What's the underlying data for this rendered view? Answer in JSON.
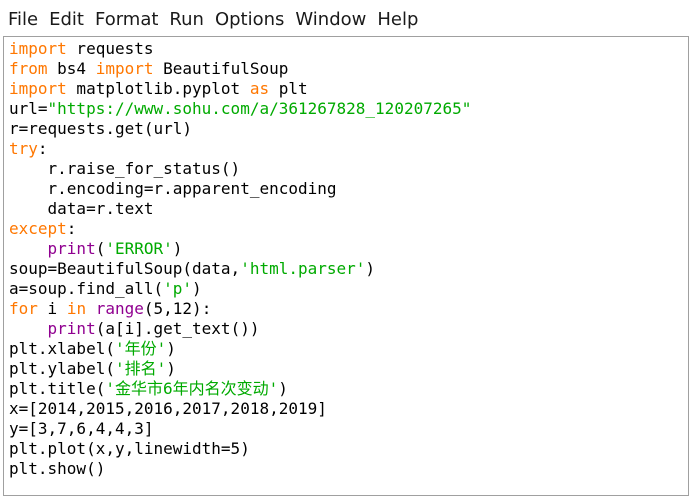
{
  "menubar": {
    "items": [
      "File",
      "Edit",
      "Format",
      "Run",
      "Options",
      "Window",
      "Help"
    ]
  },
  "colors": {
    "keyword": "#ff7700",
    "builtin": "#900090",
    "string": "#00aa00",
    "text": "#000000"
  },
  "editor": {
    "lines": [
      [
        {
          "t": "import",
          "c": "kw"
        },
        {
          "t": " requests"
        }
      ],
      [
        {
          "t": "from",
          "c": "kw"
        },
        {
          "t": " bs4 "
        },
        {
          "t": "import",
          "c": "kw"
        },
        {
          "t": " BeautifulSoup"
        }
      ],
      [
        {
          "t": "import",
          "c": "kw"
        },
        {
          "t": " matplotlib.pyplot "
        },
        {
          "t": "as",
          "c": "kw"
        },
        {
          "t": " plt"
        }
      ],
      [
        {
          "t": "url="
        },
        {
          "t": "\"https://www.sohu.com/a/361267828_120207265\"",
          "c": "str"
        }
      ],
      [
        {
          "t": "r=requests.get(url)"
        }
      ],
      [
        {
          "t": "try",
          "c": "kw"
        },
        {
          "t": ":"
        }
      ],
      [
        {
          "t": "    r.raise_for_status()"
        }
      ],
      [
        {
          "t": "    r.encoding=r.apparent_encoding"
        }
      ],
      [
        {
          "t": "    data=r.text"
        }
      ],
      [
        {
          "t": "except",
          "c": "kw"
        },
        {
          "t": ":"
        }
      ],
      [
        {
          "t": "    "
        },
        {
          "t": "print",
          "c": "bi"
        },
        {
          "t": "("
        },
        {
          "t": "'ERROR'",
          "c": "str"
        },
        {
          "t": ")"
        }
      ],
      [
        {
          "t": "soup=BeautifulSoup(data,"
        },
        {
          "t": "'html.parser'",
          "c": "str"
        },
        {
          "t": ")"
        }
      ],
      [
        {
          "t": "a=soup.find_all("
        },
        {
          "t": "'p'",
          "c": "str"
        },
        {
          "t": ")"
        }
      ],
      [
        {
          "t": "for",
          "c": "kw"
        },
        {
          "t": " i "
        },
        {
          "t": "in",
          "c": "kw"
        },
        {
          "t": " "
        },
        {
          "t": "range",
          "c": "bi"
        },
        {
          "t": "(5,12):"
        }
      ],
      [
        {
          "t": "    "
        },
        {
          "t": "print",
          "c": "bi"
        },
        {
          "t": "(a[i].get_text())"
        }
      ],
      [
        {
          "t": "plt.xlabel("
        },
        {
          "t": "'年份'",
          "c": "str"
        },
        {
          "t": ")"
        }
      ],
      [
        {
          "t": "plt.ylabel("
        },
        {
          "t": "'排名'",
          "c": "str"
        },
        {
          "t": ")"
        }
      ],
      [
        {
          "t": "plt.title("
        },
        {
          "t": "'金华市6年内名次变动'",
          "c": "str"
        },
        {
          "t": ")"
        }
      ],
      [
        {
          "t": "x=[2014,2015,2016,2017,2018,2019]"
        }
      ],
      [
        {
          "t": "y=[3,7,6,4,4,3]"
        }
      ],
      [
        {
          "t": "plt.plot(x,y,linewidth=5)"
        }
      ],
      [
        {
          "t": "plt.show()"
        }
      ]
    ]
  }
}
